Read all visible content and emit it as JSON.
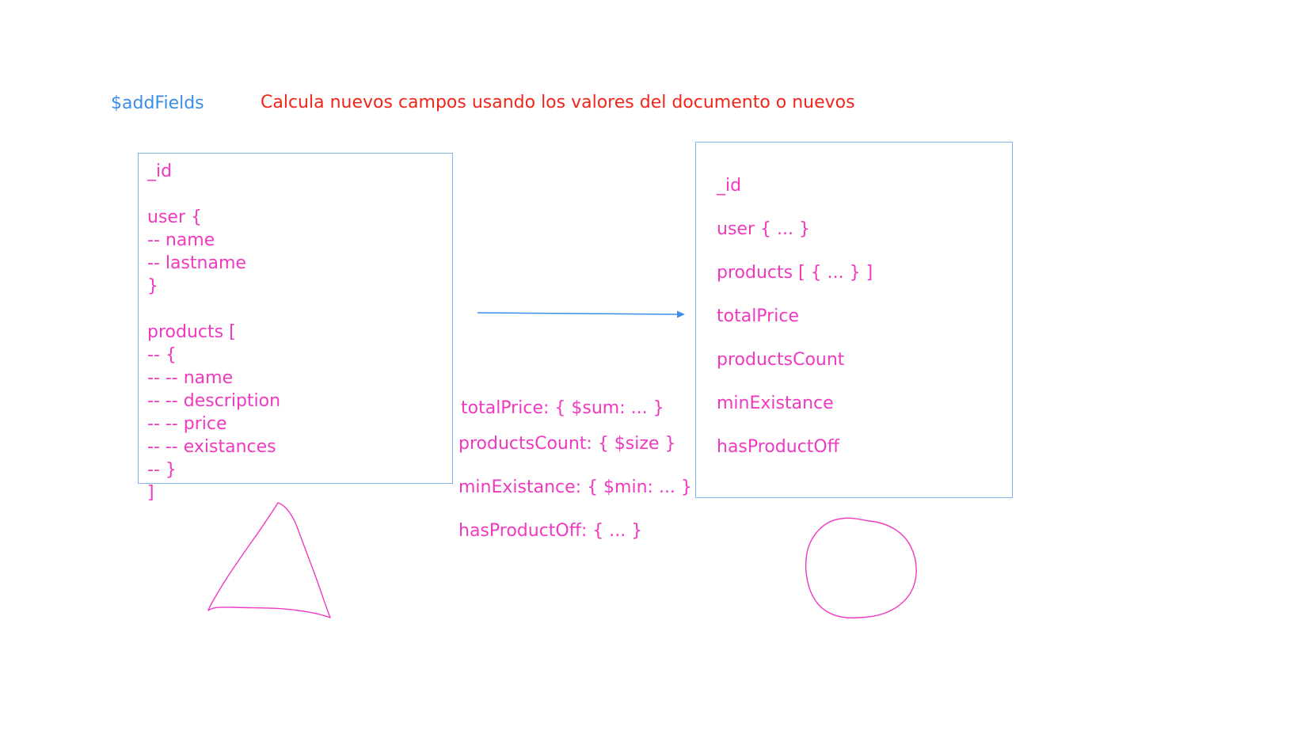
{
  "title": "$addFields",
  "description": "Calcula nuevos campos usando los valores del documento o nuevos",
  "input_document": {
    "lines": [
      "_id",
      "",
      "user {",
      "-- name",
      "-- lastname",
      "}",
      "",
      "products [",
      "-- {",
      "-- -- name",
      "-- -- description",
      "-- -- price",
      "-- -- existances",
      "-- }",
      "]"
    ]
  },
  "operations": [
    "totalPrice: { $sum: ... }",
    "productsCount: { $size }",
    "minExistance: { $min: ... }",
    "hasProductOff: { ... }"
  ],
  "output_document": {
    "lines": [
      "_id",
      "user { ... }",
      "products [ { ... } ]",
      "totalPrice",
      "productsCount",
      "minExistance",
      "hasProductOff"
    ]
  },
  "colors": {
    "stage_label": "#3a8ee6",
    "description": "#f0261a",
    "ink": "#ef39c0",
    "box_border": "#7fb3ef",
    "arrow": "#3a8ee6"
  }
}
